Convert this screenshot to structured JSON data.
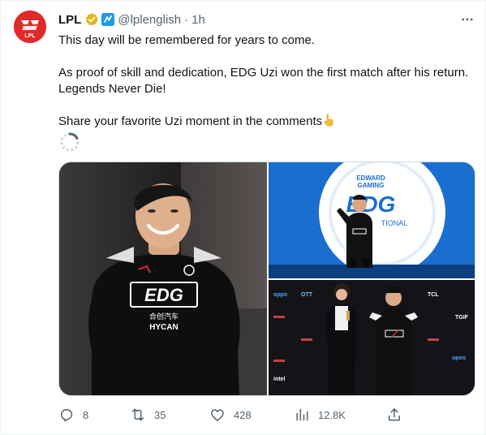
{
  "author": {
    "name": "LPL",
    "handle": "@lplenglish",
    "time": "1h",
    "avatar_text": "LPL"
  },
  "tweet": {
    "line1": "This day will be remembered for years to come.",
    "line2": "As proof of skill and dedication, EDG Uzi won the first match after his return. Legends Never Die!",
    "line3": "Share your favorite Uzi moment in the comments"
  },
  "media": {
    "left_jersey_text": "EDG",
    "left_sponsor_line1": "合创汽车",
    "left_sponsor_line2": "HYCAN",
    "tr_banner_line1": "EDWARD",
    "tr_banner_line2": "GAMING",
    "tr_banner_logo": "EDG",
    "tr_banner_tail": "TIONAL",
    "br_wall_brands": [
      "oppo",
      "OTT",
      "TCL",
      "TGIF",
      "intel",
      "opoo"
    ]
  },
  "actions": {
    "replies": "8",
    "retweets": "35",
    "likes": "428",
    "views": "12.8K"
  },
  "colors": {
    "text": "#0f1419",
    "muted": "#536471",
    "verified_gold": "#e2b719",
    "brand_red": "#e02a2a"
  },
  "icons": [
    "verified-badge-icon",
    "affiliate-icon",
    "more-icon",
    "reply-icon",
    "retweet-icon",
    "like-icon",
    "views-icon",
    "share-icon",
    "point-down-emoji-icon",
    "loading-spinner-icon"
  ]
}
